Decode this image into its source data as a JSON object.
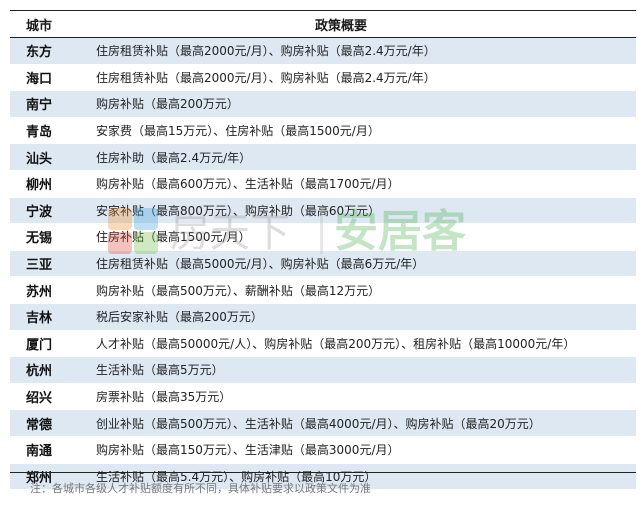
{
  "table": {
    "header": {
      "city": "城市",
      "policy": "政策概要"
    },
    "rows": [
      {
        "city": "东方",
        "policy": "住房租赁补贴（最高2000元/月）、购房补贴（最高2.4万元/年）"
      },
      {
        "city": "海口",
        "policy": "住房租赁补贴（最高2000元/月）、购房补贴（最高2.4万元/年）"
      },
      {
        "city": "南宁",
        "policy": "购房补贴（最高200万元）"
      },
      {
        "city": "青岛",
        "policy": "安家费（最高15万元）、住房补贴（最高1500元/月）"
      },
      {
        "city": "汕头",
        "policy": "住房补助（最高2.4万元/年）"
      },
      {
        "city": "柳州",
        "policy": "购房补贴（最高600万元）、生活补贴（最高1700元/月）"
      },
      {
        "city": "宁波",
        "policy": "安家补贴（最高800万元）、购房补助（最高60万元）"
      },
      {
        "city": "无锡",
        "policy": "住房补贴（最高1500元/月）"
      },
      {
        "city": "三亚",
        "policy": "住房租赁补贴（最高5000元/月）、购房补贴（最高6万元/年）"
      },
      {
        "city": "苏州",
        "policy": "购房补贴（最高500万元）、薪酬补贴（最高12万元）"
      },
      {
        "city": "吉林",
        "policy": "税后安家补贴（最高200万元）"
      },
      {
        "city": "厦门",
        "policy": "人才补贴（最高50000元/人）、购房补贴（最高200万元）、租房补贴（最高10000元/年）"
      },
      {
        "city": "杭州",
        "policy": "生活补贴（最高5万元）"
      },
      {
        "city": "绍兴",
        "policy": "房票补贴（最高35万元）"
      },
      {
        "city": "常德",
        "policy": "创业补贴（最高500万元）、生活补贴（最高4000元/月）、购房补贴（最高20万元）"
      },
      {
        "city": "南通",
        "policy": "购房补贴（最高150万元）、生活津贴（最高3000元/月）"
      },
      {
        "city": "郑州",
        "policy": "生活补贴（最高5.4万元）、购房补贴（最高10万元）"
      }
    ]
  },
  "note": "注：各城市各级人才补贴额度有所不同，具体补贴要求以政策文件为准",
  "watermark": {
    "text_left": "房天下",
    "text_right": "安居客",
    "icon": "house-logo-icon"
  },
  "colors": {
    "row_shade": "#dde8f3",
    "rule": "#222222",
    "note": "#777777",
    "watermark": "#3aa0d8"
  }
}
